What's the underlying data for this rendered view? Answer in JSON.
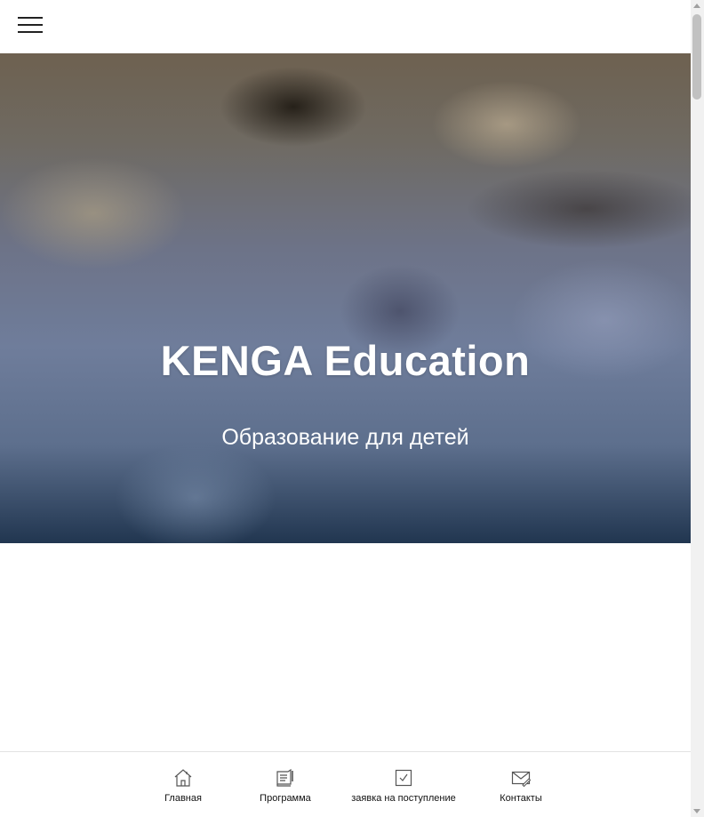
{
  "header": {
    "menu_icon": "hamburger-menu-icon"
  },
  "hero": {
    "title": "KENGA Education",
    "subtitle": "Образование для детей"
  },
  "bottom_nav": {
    "items": [
      {
        "label": "Главная",
        "icon": "home-icon"
      },
      {
        "label": "Программа",
        "icon": "program-icon"
      },
      {
        "label": "заявка на поступление",
        "icon": "checkbox-icon"
      },
      {
        "label": "Контакты",
        "icon": "envelope-icon"
      }
    ]
  },
  "colors": {
    "hero_text": "#ffffff",
    "nav_text": "#111111",
    "icon_stroke": "#555555"
  }
}
